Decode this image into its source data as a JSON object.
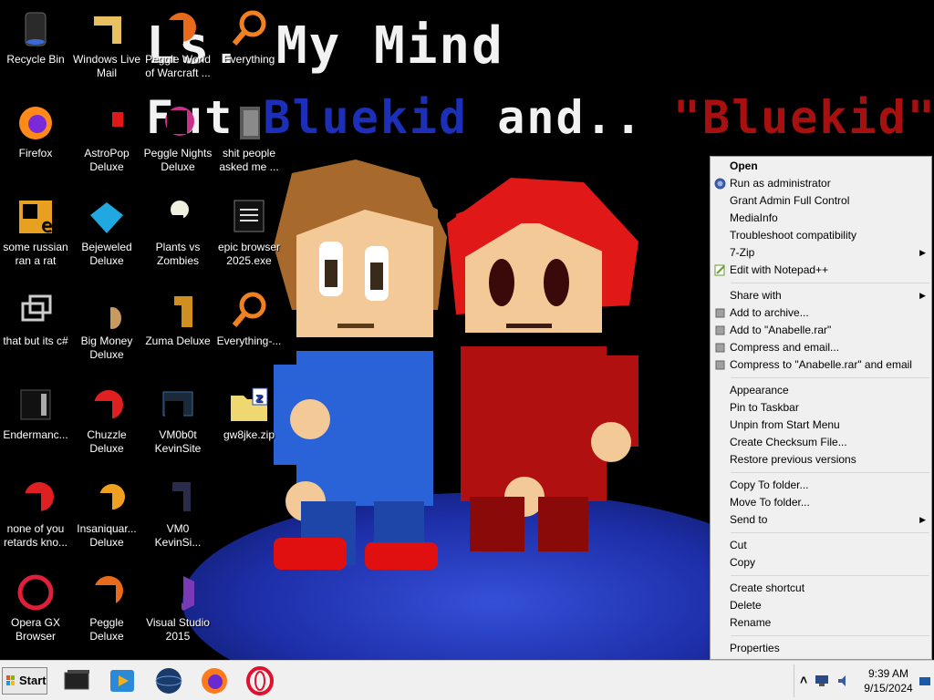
{
  "wallpaper": {
    "line1": "Ls. My Mind",
    "line2_a": "Fut ",
    "line2_b": "Bluekid",
    "line2_c": " and.. ",
    "line2_d": "\"Bluekid\"?"
  },
  "desktop_icons": [
    {
      "label": "Recycle Bin",
      "icon": "recycle-bin-icon"
    },
    {
      "label": "Windows Live Mail",
      "icon": "mail-icon"
    },
    {
      "label": "Peggle World of Warcraft ...",
      "icon": "peggle-icon"
    },
    {
      "label": "Everything",
      "icon": "search-magnifier-icon"
    },
    {
      "label": "Firefox",
      "icon": "firefox-icon"
    },
    {
      "label": "AstroPop Deluxe",
      "icon": "astropop-icon"
    },
    {
      "label": "Peggle Nights Deluxe",
      "icon": "peggle-nights-icon"
    },
    {
      "label": "shit people asked me ...",
      "icon": "folder-icon"
    },
    {
      "label": "some russian ran a rat",
      "icon": "russian-icon"
    },
    {
      "label": "Bejeweled Deluxe",
      "icon": "bejeweled-icon"
    },
    {
      "label": "Plants vs Zombies",
      "icon": "plants-vs-zombies-icon"
    },
    {
      "label": "epic browser 2025.exe",
      "icon": "exe-icon"
    },
    {
      "label": "that but its c#",
      "icon": "shortcut-icon"
    },
    {
      "label": "Big Money Deluxe",
      "icon": "big-money-icon"
    },
    {
      "label": "Zuma Deluxe",
      "icon": "zuma-icon"
    },
    {
      "label": "Everything-...",
      "icon": "search-magnifier-icon"
    },
    {
      "label": "Endermanc...",
      "icon": "enderman-icon"
    },
    {
      "label": "Chuzzle Deluxe",
      "icon": "chuzzle-icon"
    },
    {
      "label": "VM0b0t KevinSite",
      "icon": "vm-icon"
    },
    {
      "label": "gw8jke.zip",
      "icon": "zip-folder-icon"
    },
    {
      "label": "none of you retards kno...",
      "icon": "app-icon"
    },
    {
      "label": "Insaniquar... Deluxe",
      "icon": "insaniquarium-icon"
    },
    {
      "label": "VM0 KevinSi...",
      "icon": "vm-icon"
    },
    {
      "label": "Opera GX Browser",
      "icon": "opera-gx-icon"
    },
    {
      "label": "Peggle Deluxe",
      "icon": "peggle-icon"
    },
    {
      "label": "Visual Studio 2015",
      "icon": "visual-studio-icon"
    }
  ],
  "context_menu": {
    "open": "Open",
    "run_as_admin": "Run as administrator",
    "grant_admin": "Grant Admin Full Control",
    "mediainfo": "MediaInfo",
    "troubleshoot": "Troubleshoot compatibility",
    "seven_zip": "7-Zip",
    "edit_notepad": "Edit with Notepad++",
    "share_with": "Share with",
    "add_archive": "Add to archive...",
    "add_rar": "Add to \"Anabelle.rar\"",
    "compress_email": "Compress and email...",
    "compress_rar_email": "Compress to \"Anabelle.rar\" and email",
    "appearance": "Appearance",
    "pin_taskbar": "Pin to Taskbar",
    "unpin_start": "Unpin from Start Menu",
    "checksum": "Create Checksum File...",
    "restore": "Restore previous versions",
    "copy_folder": "Copy To folder...",
    "move_folder": "Move To folder...",
    "send_to": "Send to",
    "cut": "Cut",
    "copy": "Copy",
    "create_shortcut": "Create shortcut",
    "delete": "Delete",
    "rename": "Rename",
    "properties": "Properties",
    "submenu_arrow": "▶"
  },
  "taskbar": {
    "start_label": "Start",
    "pinned": [
      "terminal-icon",
      "media-player-icon",
      "globe-icon",
      "firefox-icon",
      "opera-icon"
    ],
    "tray_chevron": "˄",
    "clock_time": "9:39 AM",
    "clock_date": "9/15/2024"
  },
  "colors": {
    "menu_bg": "#f0f0f0",
    "taskbar_bg": "#f0f0f0",
    "wallpaper_blue_text": "#1c2fb8",
    "wallpaper_red_text": "#a81010"
  }
}
